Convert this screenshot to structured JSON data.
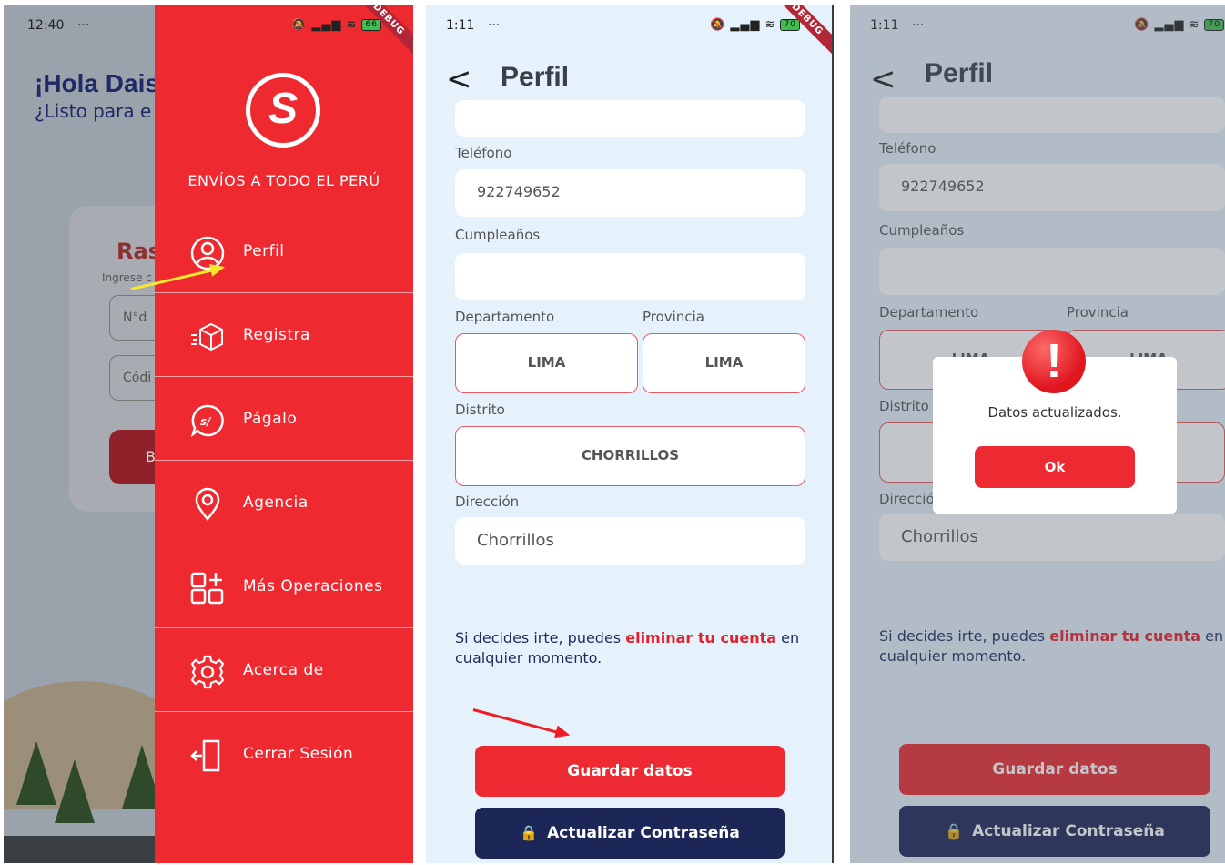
{
  "panel_home": {
    "status": {
      "time": "12:40",
      "dots": "···",
      "battery": "66"
    },
    "debug_label": "DEBUG",
    "greeting": "¡Hola Dais",
    "subgreeting": "¿Listo para e",
    "card_title": "Ras",
    "card_sub": "Ingrese c",
    "input1": "N°d",
    "input2": "Códi",
    "button": "B",
    "drawer": {
      "logo": "S",
      "tagline": "ENVÍOS A TODO EL PERÚ",
      "items": [
        {
          "label": "Perfil",
          "icon": "user-circle-icon"
        },
        {
          "label": "Registra",
          "icon": "package-icon"
        },
        {
          "label": "Págalo",
          "icon": "payment-bubble-icon"
        },
        {
          "label": "Agencia",
          "icon": "location-pin-icon"
        },
        {
          "label": "Más Operaciones",
          "icon": "grid-plus-icon"
        },
        {
          "label": "Acerca de",
          "icon": "gear-icon"
        },
        {
          "label": "Cerrar Sesión",
          "icon": "logout-door-icon"
        }
      ]
    }
  },
  "profile": {
    "status": {
      "time": "1:11",
      "dots": "···",
      "battery": "70"
    },
    "debug_label": "DEBUG",
    "back": "<",
    "title": "Perfil",
    "phone_label": "Teléfono",
    "phone_value": "922749652",
    "birthday_label": "Cumpleaños",
    "birthday_value": "",
    "department_label": "Departamento",
    "department_value": "LIMA",
    "province_label": "Provincia",
    "province_value": "LIMA",
    "district_label": "Distrito",
    "district_value": "CHORRILLOS",
    "address_label": "Dirección",
    "address_value": "Chorrillos",
    "note_pre": "Si decides irte, puedes ",
    "note_link": "eliminar tu cuenta",
    "note_post": " en cualquier momento.",
    "save_button": "Guardar datos",
    "password_button": "Actualizar Contraseña"
  },
  "dialog": {
    "icon": "!",
    "message": "Datos actualizados.",
    "ok": "Ok",
    "partial_select_text": "LIMA",
    "address_label_cut": "Direcció",
    "district_label_cut": "Distrito"
  },
  "colors": {
    "brand_red": "#ef2930",
    "navy": "#1c2657",
    "link_red": "#e3202b"
  }
}
